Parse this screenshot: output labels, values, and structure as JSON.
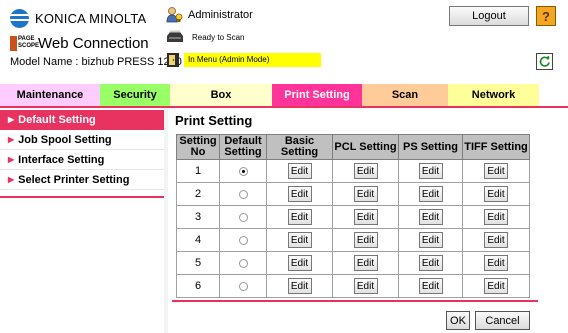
{
  "header": {
    "brand": "KONICA MINOLTA",
    "pagescope": "PAGE SCOPE",
    "app_name": "Web Connection",
    "model_label": "Model Name : bizhub PRESS 1250",
    "user": "Administrator",
    "status": "Ready to Scan",
    "mode": "In Menu (Admin Mode)",
    "logout_label": "Logout",
    "help_label": "?"
  },
  "tabs": [
    {
      "label": "Maintenance",
      "color": "#ffccff"
    },
    {
      "label": "Security",
      "color": "#99ff66"
    },
    {
      "label": "Box",
      "color": "#ffffcc"
    },
    {
      "label": "Print Setting",
      "color": "#ff3399",
      "active": true
    },
    {
      "label": "Scan",
      "color": "#ffcc99"
    },
    {
      "label": "Network",
      "color": "#ffff99"
    }
  ],
  "sidebar": {
    "items": [
      {
        "label": "Default Setting",
        "active": true
      },
      {
        "label": "Job Spool Setting"
      },
      {
        "label": "Interface Setting"
      },
      {
        "label": "Select Printer Setting"
      }
    ]
  },
  "main": {
    "title": "Print Setting",
    "columns": {
      "setting_no": "Setting No",
      "default_setting": "Default Setting",
      "basic": "Basic Setting",
      "pcl": "PCL Setting",
      "ps": "PS Setting",
      "tiff": "TIFF Setting"
    },
    "edit_label": "Edit",
    "rows": [
      {
        "no": "1",
        "default": true
      },
      {
        "no": "2",
        "default": false
      },
      {
        "no": "3",
        "default": false
      },
      {
        "no": "4",
        "default": false
      },
      {
        "no": "5",
        "default": false
      },
      {
        "no": "6",
        "default": false
      }
    ]
  },
  "actions": {
    "ok_label": "OK",
    "cancel_label": "Cancel"
  },
  "colors": {
    "accent": "#e8325f",
    "table_header": "#c0c0c0",
    "mode_badge": "#ffff00"
  }
}
